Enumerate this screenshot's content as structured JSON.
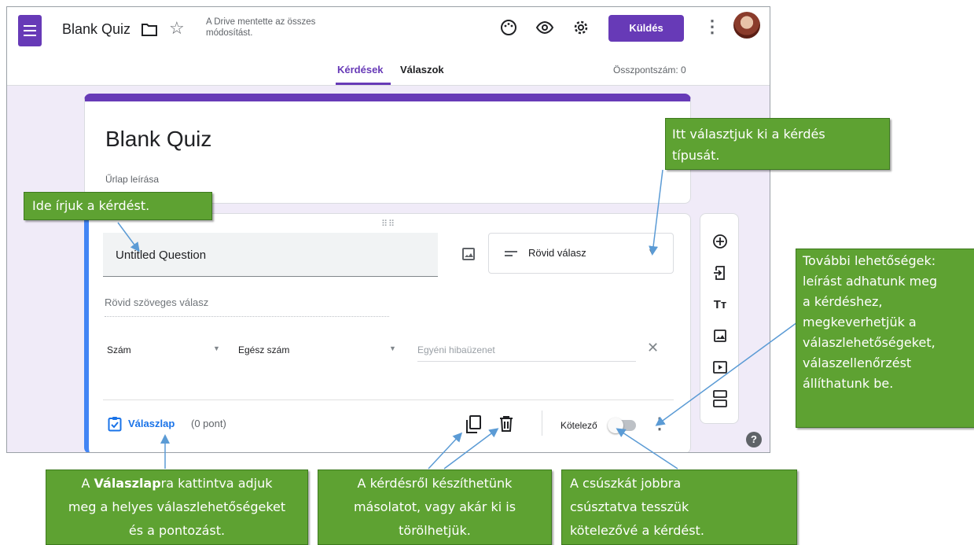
{
  "header": {
    "doc_title": "Blank Quiz",
    "save_status": "A Drive mentette az összes módosítást.",
    "send_label": "Küldés",
    "tabs": [
      {
        "label": "Kérdések",
        "active": true
      },
      {
        "label": "Válaszok",
        "active": false
      }
    ],
    "total_points": "Összpontszám: 0"
  },
  "form": {
    "title": "Blank Quiz",
    "description": "Űrlap leírása"
  },
  "question": {
    "title": "Untitled Question",
    "type": "Rövid válasz",
    "answer_placeholder": "Rövid szöveges válasz",
    "validation": {
      "type": "Szám",
      "subtype": "Egész szám",
      "error_placeholder": "Egyéni hibaüzenet"
    },
    "answer_key_label": "Válaszlap",
    "points": "(0 pont)",
    "required_label": "Kötelező",
    "required": false
  },
  "side_toolbar": [
    "add-question-icon",
    "import-questions-icon",
    "add-title-icon",
    "add-image-icon",
    "add-video-icon",
    "add-section-icon"
  ],
  "callouts": {
    "question": "Ide írjuk a kérdést.",
    "type_lines": [
      "Itt választjuk ki a kérdés",
      "típusát."
    ],
    "more_lines": [
      "További lehetőségek:",
      "leírást adhatunk meg",
      "a kérdéshez,",
      "megkeverhetjük a",
      "válaszlehetőségeket,",
      "válaszellenőrzést",
      "állíthatunk be."
    ],
    "answerkey_pre": "A ",
    "answerkey_bold": "Válaszlap",
    "answerkey_post": "ra kattintva adjuk",
    "answerkey_lines": [
      "meg a helyes válaszlehetőségeket",
      "és a pontozást."
    ],
    "copy_lines": [
      "A kérdésről készíthetünk",
      "másolatot, vagy akár ki is",
      "törölhetjük."
    ],
    "required_lines": [
      "A csúszkát jobbra",
      "csúsztatva tesszük",
      "kötelezővé a kérdést."
    ]
  },
  "colors": {
    "accent": "#673ab7",
    "question_border": "#4285f4",
    "callout_green": "#5ea232",
    "link_blue": "#1a73e8"
  }
}
